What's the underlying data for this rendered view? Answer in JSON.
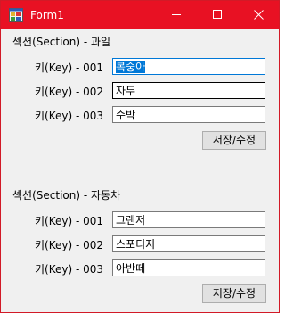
{
  "window": {
    "title": "Form1"
  },
  "sections": [
    {
      "title": "섹션(Section) - 과일",
      "rows": [
        {
          "key": "키(Key) - 001",
          "value": "복숭아"
        },
        {
          "key": "키(Key) - 002",
          "value": "자두"
        },
        {
          "key": "키(Key) - 003",
          "value": "수박"
        }
      ],
      "save_label": "저장/수정"
    },
    {
      "title": "섹션(Section) - 자동차",
      "rows": [
        {
          "key": "키(Key) - 001",
          "value": "그랜저"
        },
        {
          "key": "키(Key) - 002",
          "value": "스포티지"
        },
        {
          "key": "키(Key) - 003",
          "value": "아반떼"
        }
      ],
      "save_label": "저장/수정"
    }
  ],
  "colors": {
    "titlebar": "#e81123",
    "focus_border": "#0078d7",
    "selection": "#0078d7"
  },
  "icons": [
    "app-icon",
    "minimize-icon",
    "maximize-icon",
    "close-icon"
  ]
}
